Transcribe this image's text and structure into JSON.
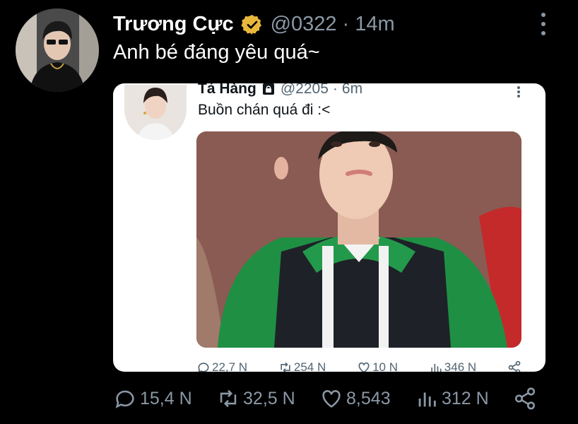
{
  "outer_tweet": {
    "author_name": "Trương Cực",
    "handle": "@0322",
    "separator": "·",
    "time": "14m",
    "text": "Anh bé đáng yêu quá~",
    "actions": {
      "replies": "15,4 N",
      "retweets": "32,5 N",
      "likes": "8,543",
      "views": "312 N"
    },
    "icons": {
      "verified": "verified-badge-icon",
      "menu": "more-vertical-icon",
      "reply": "reply-icon",
      "retweet": "retweet-icon",
      "like": "heart-icon",
      "views": "views-icon",
      "share": "share-icon"
    }
  },
  "quoted_tweet": {
    "author_name": "Tả Hàng",
    "handle": "@2205",
    "separator": "·",
    "time": "6m",
    "text": "Buồn chán quá đi :<",
    "actions": {
      "replies": "22,7 N",
      "retweets": "254 N",
      "likes": "10 N",
      "views": "346 N"
    },
    "icons": {
      "lock": "lock-icon",
      "menu": "more-vertical-icon"
    }
  },
  "colors": {
    "background": "#000000",
    "muted_text": "#8b98a5",
    "verified_gold": "#e8b83b",
    "card_background": "#ffffff"
  }
}
